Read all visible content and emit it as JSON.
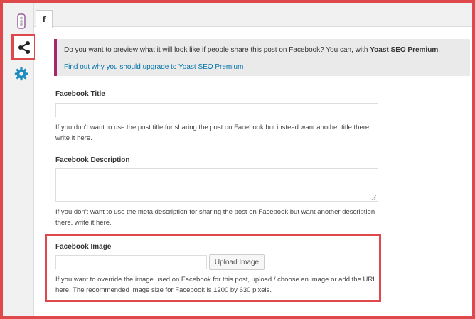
{
  "tabs": {
    "facebook_tab_label": "f"
  },
  "sidebar": {
    "items": [
      {
        "name": "readability-traffic-light-icon"
      },
      {
        "name": "social-share-icon"
      },
      {
        "name": "settings-gear-icon"
      }
    ]
  },
  "notice": {
    "text_before": "Do you want to preview what it will look like if people share this post on Facebook? You can, with ",
    "text_bold": "Yoast SEO Premium",
    "text_after": ".",
    "link": "Find out why you should upgrade to Yoast SEO Premium"
  },
  "fields": {
    "title": {
      "label": "Facebook Title",
      "value": "",
      "help": "If you don't want to use the post title for sharing the post on Facebook but instead want another title there, write it here."
    },
    "description": {
      "label": "Facebook Description",
      "value": "",
      "help": "If you don't want to use the meta description for sharing the post on Facebook but want another description there, write it here."
    },
    "image": {
      "label": "Facebook Image",
      "value": "",
      "button": "Upload Image",
      "help": "If you want to override the image used on Facebook for this post, upload / choose an image or add the URL here. The recommended image size for Facebook is 1200 by 630 pixels."
    }
  },
  "colors": {
    "highlight": "#e0494b",
    "premium_accent": "#a4286a",
    "link": "#0073aa",
    "icon_blue": "#1e8cbe"
  }
}
